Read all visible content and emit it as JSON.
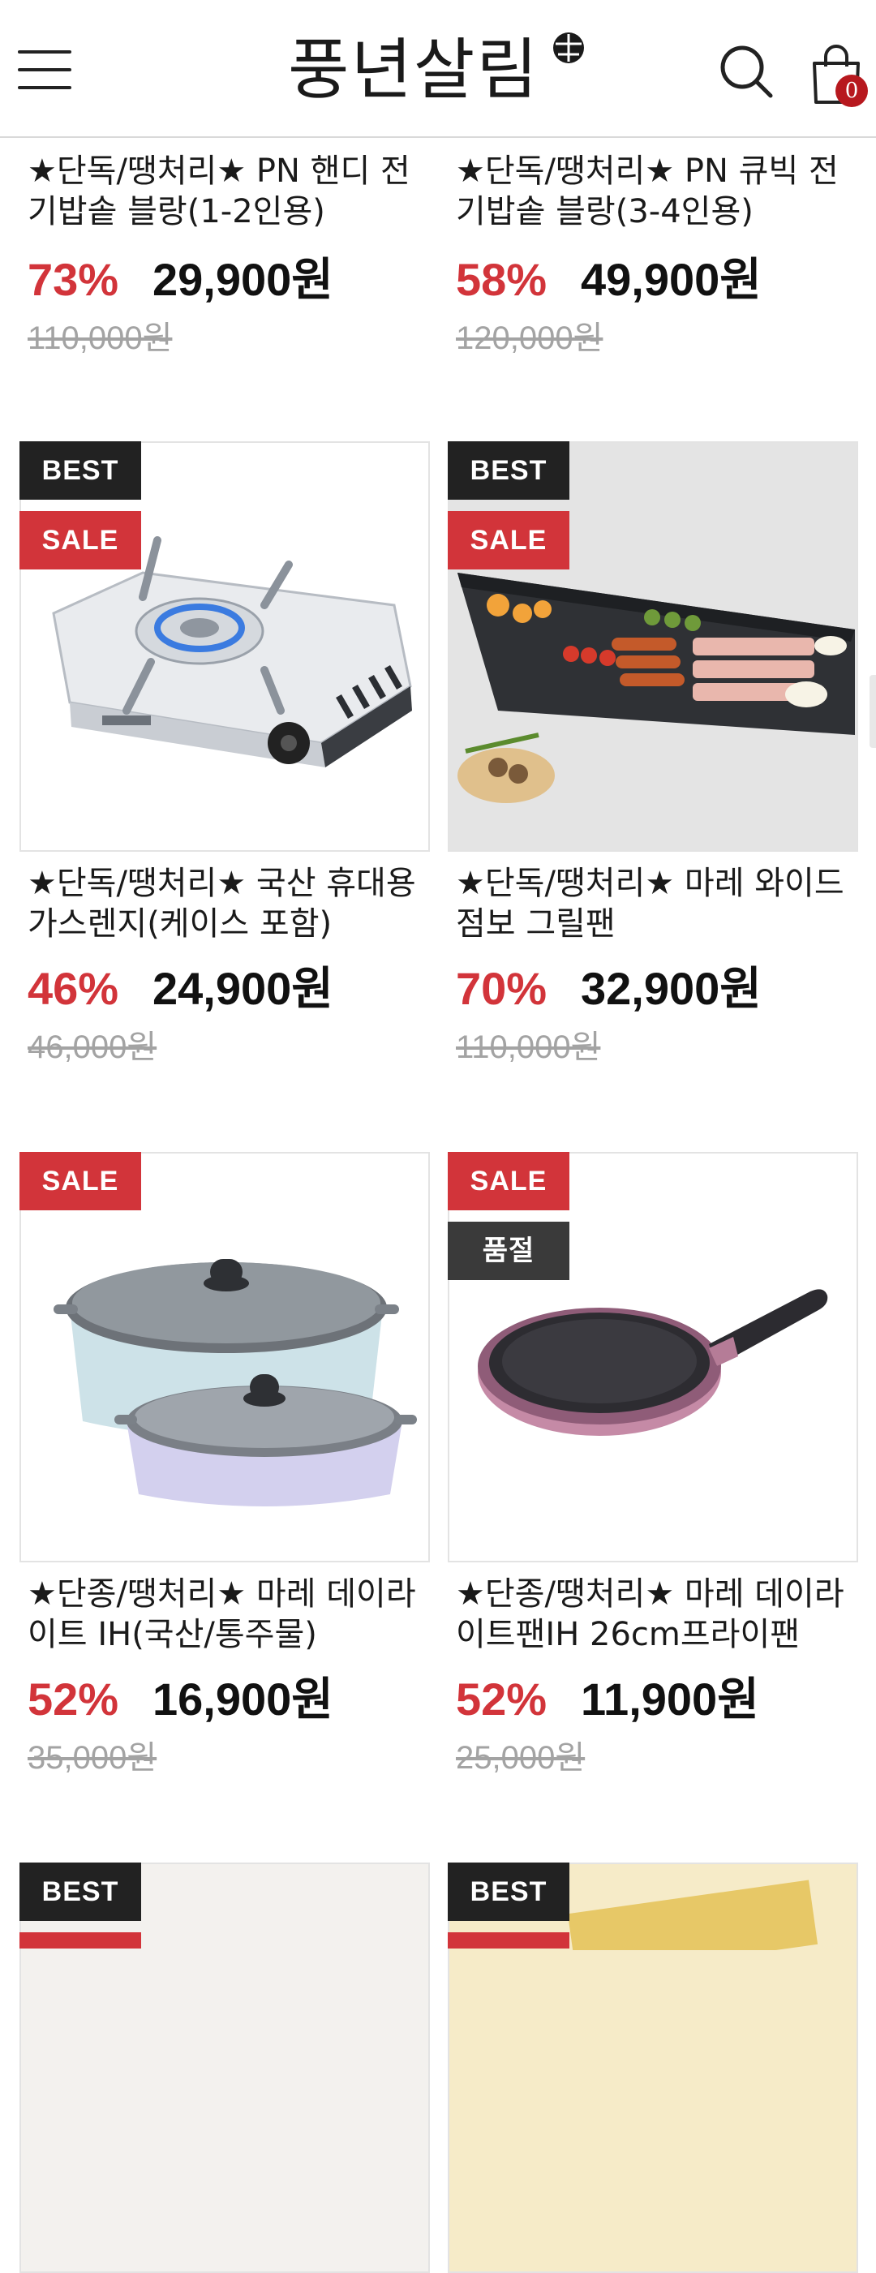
{
  "header": {
    "logo_text": "풍년살림",
    "cart_count": "0"
  },
  "products": [
    {
      "title": "★단독/땡처리★ PN 핸디 전기밥솥 블랑(1-2인용)",
      "discount": "73%",
      "price": "29,900원",
      "original_price": "110,000원",
      "badges": []
    },
    {
      "title": "★단독/땡처리★ PN 큐빅 전기밥솥 블랑(3-4인용)",
      "discount": "58%",
      "price": "49,900원",
      "original_price": "120,000원",
      "badges": []
    },
    {
      "title": "★단독/땡처리★ 국산 휴대용 가스렌지(케이스 포함)",
      "discount": "46%",
      "price": "24,900원",
      "original_price": "46,000원",
      "badges": [
        "BEST",
        "SALE"
      ],
      "image_icon": "gas-stove-icon"
    },
    {
      "title": "★단독/땡처리★ 마레 와이드 점보 그릴팬",
      "discount": "70%",
      "price": "32,900원",
      "original_price": "110,000원",
      "badges": [
        "BEST",
        "SALE"
      ],
      "image_icon": "grill-pan-icon"
    },
    {
      "title": "★단종/땡처리★ 마레 데이라이트 IH(국산/통주물)",
      "discount": "52%",
      "price": "16,900원",
      "original_price": "35,000원",
      "badges": [
        "SALE"
      ],
      "image_icon": "pot-set-icon"
    },
    {
      "title": "★단종/땡처리★ 마레 데이라이트팬IH 26cm프라이팬",
      "discount": "52%",
      "price": "11,900원",
      "original_price": "25,000원",
      "badges": [
        "SALE",
        "품절"
      ],
      "image_icon": "frying-pan-icon"
    },
    {
      "badges": [
        "BEST"
      ]
    },
    {
      "badges": [
        "BEST"
      ]
    }
  ],
  "colors": {
    "accent_red": "#d2343a",
    "badge_dark": "#222222",
    "cart_badge": "#b7181e"
  }
}
